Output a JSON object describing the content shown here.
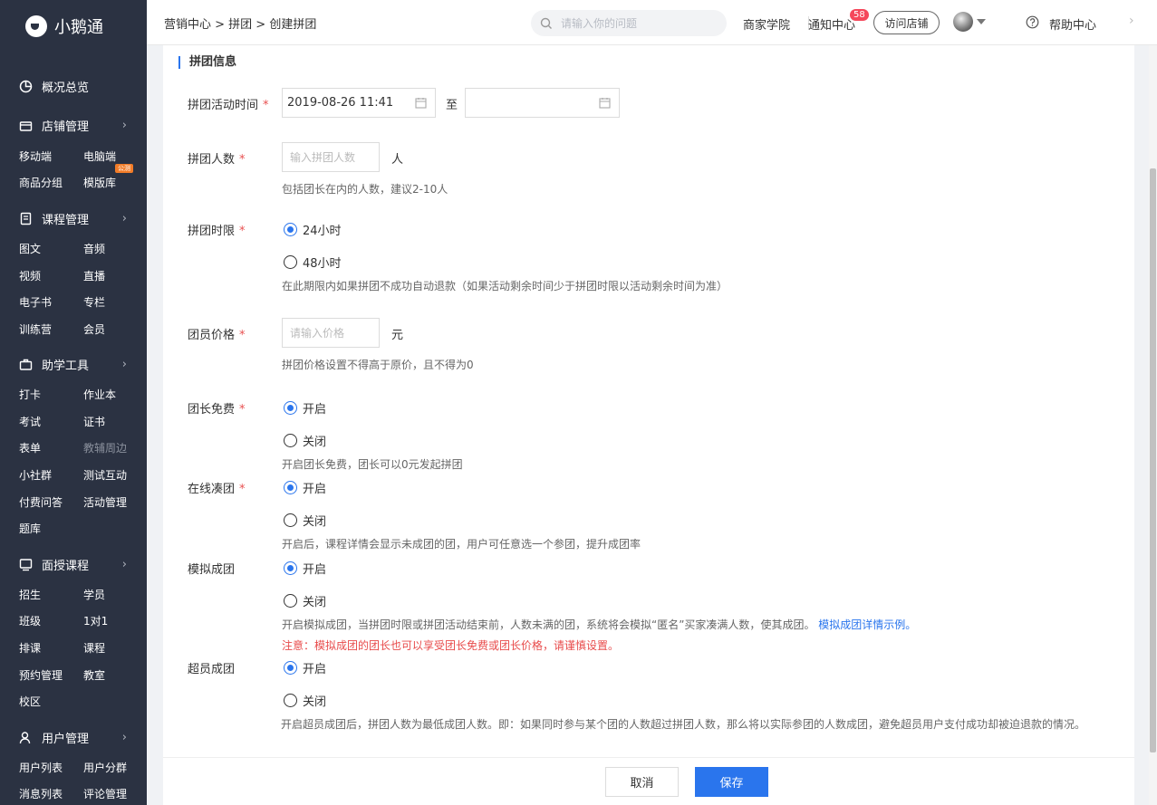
{
  "app": {
    "name": "小鹅通"
  },
  "sidebar": {
    "overview": "概况总览",
    "groups": [
      {
        "title": "店铺管理",
        "icon": "store-icon",
        "items": [
          [
            "移动端",
            "电脑端"
          ],
          [
            "商品分组",
            "模版库"
          ]
        ]
      },
      {
        "title": "课程管理",
        "icon": "book-icon",
        "items": [
          [
            "图文",
            "音频"
          ],
          [
            "视频",
            "直播"
          ],
          [
            "电子书",
            "专栏"
          ],
          [
            "训练营",
            "会员"
          ]
        ]
      },
      {
        "title": "助学工具",
        "icon": "toolbox-icon",
        "items": [
          [
            "打卡",
            "作业本"
          ],
          [
            "考试",
            "证书"
          ],
          [
            "表单",
            "教辅周边"
          ],
          [
            "小社群",
            "测试互动"
          ],
          [
            "付费问答",
            "活动管理"
          ],
          [
            "题库",
            ""
          ]
        ]
      },
      {
        "title": "面授课程",
        "icon": "classroom-icon",
        "items": [
          [
            "招生",
            "学员"
          ],
          [
            "班级",
            "1对1"
          ],
          [
            "排课",
            "课程"
          ],
          [
            "预约管理",
            "教室"
          ],
          [
            "校区",
            ""
          ]
        ]
      },
      {
        "title": "用户管理",
        "icon": "user-icon",
        "items": [
          [
            "用户列表",
            "用户分群"
          ],
          [
            "消息列表",
            "评论管理"
          ]
        ]
      }
    ],
    "new_badge": "公测"
  },
  "header": {
    "breadcrumb": "营销中心 > 拼团 > 创建拼团",
    "search_placeholder": "请输入你的问题",
    "academy": "商家学院",
    "notice": "通知中心",
    "notice_count": "58",
    "visit_store": "访问店铺",
    "help": "帮助中心"
  },
  "form": {
    "section_title": "拼团信息",
    "required_mark": "*",
    "time_label": "拼团活动时间",
    "start_time": "2019-08-26 11:41",
    "to_text": "至",
    "end_time": "",
    "size_label": "拼团人数",
    "size_placeholder": "输入拼团人数",
    "size_unit": "人",
    "size_hint": "包括团长在内的人数，建议2-10人",
    "limit_label": "拼团时限",
    "limit_options": [
      "24小时",
      "48小时"
    ],
    "limit_selected": 0,
    "limit_hint": "在此期限内如果拼团不成功自动退款（如果活动剩余时间少于拼团时限以活动剩余时间为准）",
    "price_label": "团员价格",
    "price_placeholder": "请输入价格",
    "price_unit": "元",
    "price_hint": "拼团价格设置不得高于原价，且不得为0",
    "leader_free_label": "团长免费",
    "on": "开启",
    "off": "关闭",
    "leader_free_hint": "开启团长免费，团长可以0元发起拼团",
    "online_label": "在线凑团",
    "online_hint": "开启后，课程详情会显示未成团的团，用户可任意选一个参团，提升成团率",
    "simulate_label": "模拟成团",
    "simulate_hint": "开启模拟成团，当拼团时限或拼团活动结束前，人数未满的团，系统将会模拟“匿名”买家凑满人数，使其成团。",
    "simulate_link": "模拟成团详情示例。",
    "simulate_warning": "注意：模拟成团的团长也可以享受团长免费或团长价格，请谨慎设置。",
    "over_label": "超员成团",
    "over_hint": "开启超员成团后，拼团人数为最低成团人数。即：如果同时参与某个团的人数超过拼团人数，那么将以实际参团的人数成团，避免超员用户支付成功却被迫退款的情况。"
  },
  "footer": {
    "cancel": "取消",
    "save": "保存"
  },
  "colors": {
    "primary": "#2a75ed",
    "sidebar_bg": "#2b3242",
    "required": "#e85050"
  }
}
